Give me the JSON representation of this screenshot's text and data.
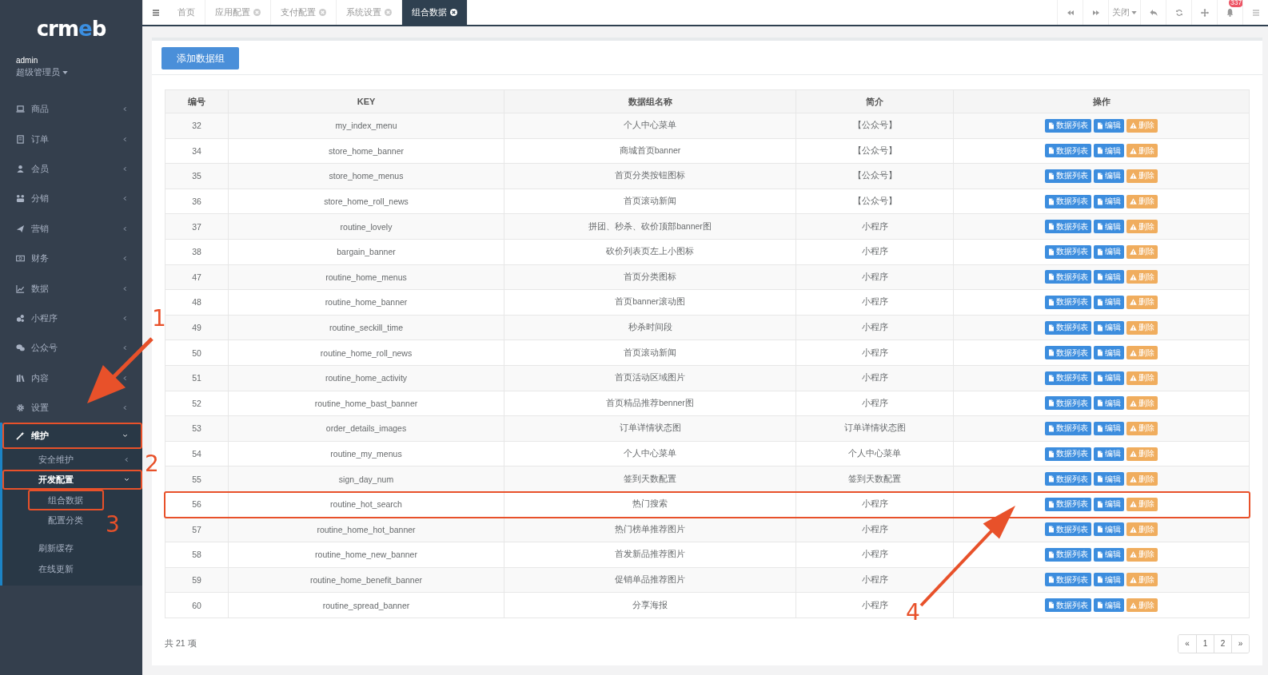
{
  "sidebar": {
    "logo": "crmeb",
    "user": "admin",
    "role": "超级管理员",
    "menu": [
      {
        "label": "商品",
        "expanded": false,
        "highlighted": false
      },
      {
        "label": "订单",
        "expanded": false,
        "highlighted": false
      },
      {
        "label": "会员",
        "expanded": false,
        "highlighted": false
      },
      {
        "label": "分销",
        "expanded": false,
        "highlighted": false
      },
      {
        "label": "营销",
        "expanded": false,
        "highlighted": false
      },
      {
        "label": "财务",
        "expanded": false,
        "highlighted": false
      },
      {
        "label": "数据",
        "expanded": false,
        "highlighted": false
      },
      {
        "label": "小程序",
        "expanded": false,
        "highlighted": false
      },
      {
        "label": "公众号",
        "expanded": false,
        "highlighted": false
      },
      {
        "label": "内容",
        "expanded": false,
        "highlighted": false
      },
      {
        "label": "设置",
        "expanded": false,
        "highlighted": false
      },
      {
        "label": "维护",
        "expanded": true,
        "highlighted": true,
        "children": [
          {
            "label": "安全维护",
            "expanded": false,
            "highlighted": false
          },
          {
            "label": "开发配置",
            "expanded": true,
            "highlighted": true,
            "children": [
              {
                "label": "组合数据",
                "highlighted": true
              },
              {
                "label": "配置分类",
                "highlighted": false
              }
            ]
          },
          {
            "label": "刷新缓存",
            "highlighted": false
          },
          {
            "label": "在线更新",
            "highlighted": false
          }
        ]
      }
    ]
  },
  "tabs": [
    {
      "label": "首页",
      "closable": false,
      "selected": false
    },
    {
      "label": "应用配置",
      "closable": true,
      "selected": false
    },
    {
      "label": "支付配置",
      "closable": true,
      "selected": false
    },
    {
      "label": "系统设置",
      "closable": true,
      "selected": false
    },
    {
      "label": "组合数据",
      "closable": true,
      "selected": true
    }
  ],
  "toolbar": {
    "close_label": "关闭",
    "badge": "337"
  },
  "add_button": "添加数据组",
  "table": {
    "columns": [
      "编号",
      "KEY",
      "数据组名称",
      "简介",
      "操作"
    ],
    "rows": [
      {
        "id": "32",
        "key": "my_index_menu",
        "name": "个人中心菜单",
        "intro": "【公众号】",
        "highlighted": false,
        "actions": [
          {
            "kind": "list",
            "label": "数据列表"
          },
          {
            "kind": "edit",
            "label": "编辑"
          },
          {
            "kind": "delete",
            "label": "删除"
          }
        ]
      },
      {
        "id": "34",
        "key": "store_home_banner",
        "name": "商城首页banner",
        "intro": "【公众号】",
        "highlighted": false,
        "actions": [
          {
            "kind": "list",
            "label": "数据列表"
          },
          {
            "kind": "edit",
            "label": "编辑"
          },
          {
            "kind": "delete",
            "label": "删除"
          }
        ]
      },
      {
        "id": "35",
        "key": "store_home_menus",
        "name": "首页分类按钮图标",
        "intro": "【公众号】",
        "highlighted": false,
        "actions": [
          {
            "kind": "list",
            "label": "数据列表"
          },
          {
            "kind": "edit",
            "label": "编辑"
          },
          {
            "kind": "delete",
            "label": "删除"
          }
        ]
      },
      {
        "id": "36",
        "key": "store_home_roll_news",
        "name": "首页滚动新闻",
        "intro": "【公众号】",
        "highlighted": false,
        "actions": [
          {
            "kind": "list",
            "label": "数据列表"
          },
          {
            "kind": "edit",
            "label": "编辑"
          },
          {
            "kind": "delete",
            "label": "删除"
          }
        ]
      },
      {
        "id": "37",
        "key": "routine_lovely",
        "name": "拼团、秒杀、砍价顶部banner图",
        "intro": "小程序",
        "highlighted": false,
        "actions": [
          {
            "kind": "list",
            "label": "数据列表"
          },
          {
            "kind": "edit",
            "label": "编辑"
          },
          {
            "kind": "delete",
            "label": "删除"
          }
        ]
      },
      {
        "id": "38",
        "key": "bargain_banner",
        "name": "砍价列表页左上小图标",
        "intro": "小程序",
        "highlighted": false,
        "actions": [
          {
            "kind": "list",
            "label": "数据列表"
          },
          {
            "kind": "edit",
            "label": "编辑"
          },
          {
            "kind": "delete",
            "label": "删除"
          }
        ]
      },
      {
        "id": "47",
        "key": "routine_home_menus",
        "name": "首页分类图标",
        "intro": "小程序",
        "highlighted": false,
        "actions": [
          {
            "kind": "list",
            "label": "数据列表"
          },
          {
            "kind": "edit",
            "label": "编辑"
          },
          {
            "kind": "delete",
            "label": "删除"
          }
        ]
      },
      {
        "id": "48",
        "key": "routine_home_banner",
        "name": "首页banner滚动图",
        "intro": "小程序",
        "highlighted": false,
        "actions": [
          {
            "kind": "list",
            "label": "数据列表"
          },
          {
            "kind": "edit",
            "label": "编辑"
          },
          {
            "kind": "delete",
            "label": "删除"
          }
        ]
      },
      {
        "id": "49",
        "key": "routine_seckill_time",
        "name": "秒杀时间段",
        "intro": "小程序",
        "highlighted": false,
        "actions": [
          {
            "kind": "list",
            "label": "数据列表"
          },
          {
            "kind": "edit",
            "label": "编辑"
          },
          {
            "kind": "delete",
            "label": "删除"
          }
        ]
      },
      {
        "id": "50",
        "key": "routine_home_roll_news",
        "name": "首页滚动新闻",
        "intro": "小程序",
        "highlighted": false,
        "actions": [
          {
            "kind": "list",
            "label": "数据列表"
          },
          {
            "kind": "edit",
            "label": "编辑"
          },
          {
            "kind": "delete",
            "label": "删除"
          }
        ]
      },
      {
        "id": "51",
        "key": "routine_home_activity",
        "name": "首页活动区域图片",
        "intro": "小程序",
        "highlighted": false,
        "actions": [
          {
            "kind": "list",
            "label": "数据列表"
          },
          {
            "kind": "edit",
            "label": "编辑"
          },
          {
            "kind": "delete",
            "label": "删除"
          }
        ]
      },
      {
        "id": "52",
        "key": "routine_home_bast_banner",
        "name": "首页精品推荐benner图",
        "intro": "小程序",
        "highlighted": false,
        "actions": [
          {
            "kind": "list",
            "label": "数据列表"
          },
          {
            "kind": "edit",
            "label": "编辑"
          },
          {
            "kind": "delete",
            "label": "删除"
          }
        ]
      },
      {
        "id": "53",
        "key": "order_details_images",
        "name": "订单详情状态图",
        "intro": "订单详情状态图",
        "highlighted": false,
        "actions": [
          {
            "kind": "list",
            "label": "数据列表"
          },
          {
            "kind": "edit",
            "label": "编辑"
          },
          {
            "kind": "delete",
            "label": "删除"
          }
        ]
      },
      {
        "id": "54",
        "key": "routine_my_menus",
        "name": "个人中心菜单",
        "intro": "个人中心菜单",
        "highlighted": false,
        "actions": [
          {
            "kind": "list",
            "label": "数据列表"
          },
          {
            "kind": "edit",
            "label": "编辑"
          },
          {
            "kind": "delete",
            "label": "删除"
          }
        ]
      },
      {
        "id": "55",
        "key": "sign_day_num",
        "name": "签到天数配置",
        "intro": "签到天数配置",
        "highlighted": false,
        "actions": [
          {
            "kind": "list",
            "label": "数据列表"
          },
          {
            "kind": "edit",
            "label": "编辑"
          },
          {
            "kind": "delete",
            "label": "删除"
          }
        ]
      },
      {
        "id": "56",
        "key": "routine_hot_search",
        "name": "热门搜索",
        "intro": "小程序",
        "highlighted": true,
        "actions": [
          {
            "kind": "list",
            "label": "数据列表"
          },
          {
            "kind": "edit",
            "label": "编辑"
          },
          {
            "kind": "delete",
            "label": "删除"
          }
        ]
      },
      {
        "id": "57",
        "key": "routine_home_hot_banner",
        "name": "热门榜单推荐图片",
        "intro": "小程序",
        "highlighted": false,
        "actions": [
          {
            "kind": "list",
            "label": "数据列表"
          },
          {
            "kind": "edit",
            "label": "编辑"
          },
          {
            "kind": "delete",
            "label": "删除"
          }
        ]
      },
      {
        "id": "58",
        "key": "routine_home_new_banner",
        "name": "首发新品推荐图片",
        "intro": "小程序",
        "highlighted": false,
        "actions": [
          {
            "kind": "list",
            "label": "数据列表"
          },
          {
            "kind": "edit",
            "label": "编辑"
          },
          {
            "kind": "delete",
            "label": "删除"
          }
        ]
      },
      {
        "id": "59",
        "key": "routine_home_benefit_banner",
        "name": "促销单品推荐图片",
        "intro": "小程序",
        "highlighted": false,
        "actions": [
          {
            "kind": "list",
            "label": "数据列表"
          },
          {
            "kind": "edit",
            "label": "编辑"
          },
          {
            "kind": "delete",
            "label": "删除"
          }
        ]
      },
      {
        "id": "60",
        "key": "routine_spread_banner",
        "name": "分享海报",
        "intro": "小程序",
        "highlighted": false,
        "actions": [
          {
            "kind": "list",
            "label": "数据列表"
          },
          {
            "kind": "edit",
            "label": "编辑"
          },
          {
            "kind": "delete",
            "label": "删除"
          }
        ]
      }
    ]
  },
  "total": "共 21 项",
  "pagination": {
    "prev": "«",
    "next": "»",
    "pages": [
      "1",
      "2"
    ]
  },
  "annotations": [
    {
      "kind": "arrow",
      "label": "1"
    },
    {
      "kind": "number",
      "label": "2"
    },
    {
      "kind": "number",
      "label": "3"
    },
    {
      "kind": "arrow",
      "label": "4"
    }
  ]
}
